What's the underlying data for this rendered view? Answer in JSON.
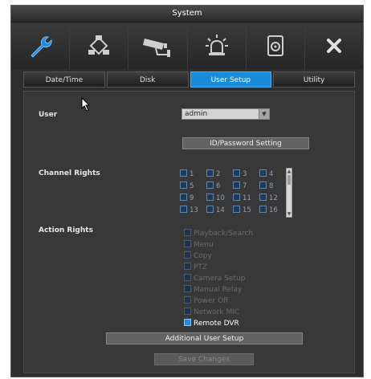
{
  "window": {
    "title": "System"
  },
  "toolbar": {
    "items": [
      {
        "icon": "wrench-icon",
        "active": true
      },
      {
        "icon": "network-icon",
        "active": false
      },
      {
        "icon": "camera-icon",
        "active": false
      },
      {
        "icon": "alarm-icon",
        "active": false
      },
      {
        "icon": "storage-icon",
        "active": false
      },
      {
        "icon": "close-icon",
        "active": false
      }
    ]
  },
  "tabs": [
    {
      "label": "Date/Time",
      "active": false
    },
    {
      "label": "Disk",
      "active": false
    },
    {
      "label": "User Setup",
      "active": true
    },
    {
      "label": "Utility",
      "active": false
    }
  ],
  "user": {
    "label": "User",
    "selected": "admin"
  },
  "id_password_button": "ID/Password Setting",
  "channel_rights": {
    "label": "Channel Rights",
    "channels": [
      "1",
      "2",
      "3",
      "4",
      "5",
      "6",
      "7",
      "8",
      "9",
      "10",
      "11",
      "12",
      "13",
      "14",
      "15",
      "16"
    ]
  },
  "action_rights": {
    "label": "Action Rights",
    "items": [
      {
        "label": "Playback/Search",
        "checked": false,
        "enabled": false
      },
      {
        "label": "Menu",
        "checked": false,
        "enabled": false
      },
      {
        "label": "Copy",
        "checked": false,
        "enabled": false
      },
      {
        "label": "PTZ",
        "checked": false,
        "enabled": false
      },
      {
        "label": "Camera Setup",
        "checked": false,
        "enabled": false
      },
      {
        "label": "Manual Relay",
        "checked": false,
        "enabled": false
      },
      {
        "label": "Power Off",
        "checked": false,
        "enabled": false
      },
      {
        "label": "Network MIC",
        "checked": false,
        "enabled": false
      },
      {
        "label": "Remote DVR",
        "checked": true,
        "enabled": true
      }
    ]
  },
  "additional_user_setup_button": "Additional User Setup",
  "save_changes_button": "Save Changes",
  "colors": {
    "accent": "#1a8bd8",
    "panel": "#383838",
    "background": "#2e2e2e"
  }
}
